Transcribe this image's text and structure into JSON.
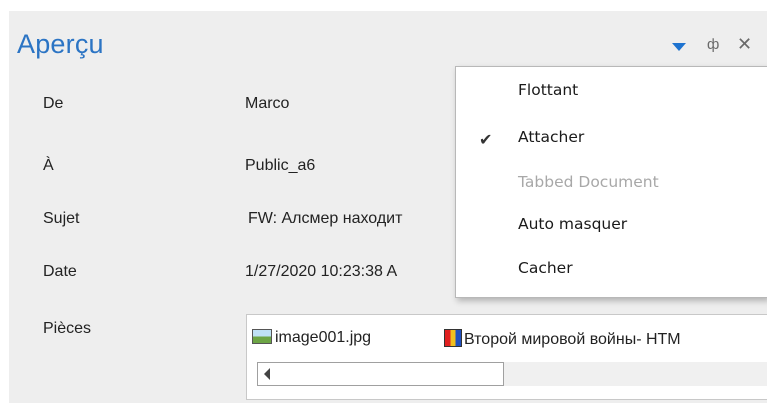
{
  "pane": {
    "title": "Aperçu",
    "icons": {
      "dropdown": "chevron-down-icon",
      "pin": "pin-icon",
      "close": "close-icon"
    },
    "pin_glyph": "ф",
    "close_glyph": "✕"
  },
  "fields": [
    {
      "label": "De",
      "value": "Marco"
    },
    {
      "label": "À",
      "value": "Public_a6"
    },
    {
      "label": "Sujet",
      "value": "FW: Алсмер находит"
    },
    {
      "label": "Date",
      "value": "1/27/2020 10:23:38 A"
    },
    {
      "label": "Pièces",
      "value": ""
    }
  ],
  "attachments": [
    {
      "name": "image001.jpg",
      "icon": "image-file-icon"
    },
    {
      "name": "Второй мировой войны- HTM",
      "icon": "html-file-icon"
    }
  ],
  "menu": {
    "items": [
      {
        "label": "Flottant",
        "checked": false,
        "disabled": false
      },
      {
        "label": "Attacher",
        "checked": true,
        "disabled": false
      },
      {
        "label": "Tabbed Document",
        "checked": false,
        "disabled": true
      },
      {
        "label": "Auto masquer",
        "checked": false,
        "disabled": false
      },
      {
        "label": "Cacher",
        "checked": false,
        "disabled": false
      }
    ],
    "check_glyph": "✔"
  },
  "colors": {
    "title": "#2b74c4",
    "dropdown_arrow": "#1e73d0",
    "pane_bg": "#eeeeee",
    "disabled_text": "#a8a8a8"
  }
}
